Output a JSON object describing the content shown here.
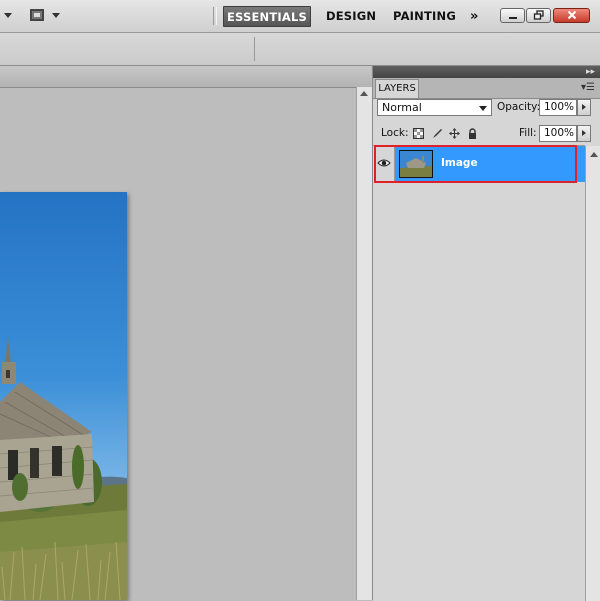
{
  "topbar": {
    "workspaces": {
      "active": "ESSENTIALS",
      "design": "DESIGN",
      "painting": "PAINTING",
      "more": "»"
    },
    "icons": [
      "dropdown-triangle-icon",
      "screen-mode-icon",
      "minimize-icon",
      "restore-icon",
      "close-icon"
    ]
  },
  "layers_panel": {
    "tab_label": "LAYERS",
    "blend_mode": "Normal",
    "opacity_label": "Opacity:",
    "opacity_value": "100%",
    "lock_label": "Lock:",
    "fill_label": "Fill:",
    "fill_value": "100%",
    "layers": [
      {
        "name": "Image",
        "visible": true,
        "selected": true
      }
    ],
    "colors": {
      "selection": "#3399ff",
      "highlight_box": "#e0202a"
    }
  }
}
